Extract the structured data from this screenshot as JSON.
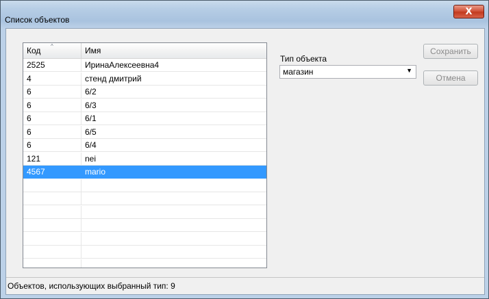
{
  "window": {
    "title": "Список объектов",
    "close_glyph": "X"
  },
  "grid": {
    "columns": {
      "code": "Код",
      "name": "Имя"
    },
    "sort_glyph": "^",
    "rows": [
      {
        "code": "2525",
        "name": "ИринаАлексеевна4"
      },
      {
        "code": "4",
        "name": "стенд дмитрий"
      },
      {
        "code": "6",
        "name": "6/2"
      },
      {
        "code": "6",
        "name": "6/3"
      },
      {
        "code": "6",
        "name": "6/1"
      },
      {
        "code": "6",
        "name": "6/5"
      },
      {
        "code": "6",
        "name": "6/4"
      },
      {
        "code": "121",
        "name": "nei"
      },
      {
        "code": "4567",
        "name": "mario",
        "selected": true
      }
    ],
    "empty_rows": 7
  },
  "object_type": {
    "label": "Тип объекта",
    "value": "магазин",
    "arrow_glyph": "▼"
  },
  "buttons": {
    "save": "Сохранить",
    "cancel": "Отмена"
  },
  "status": {
    "text": "Объектов, использующих выбранный тип: 9"
  },
  "colors": {
    "selection": "#3399ff",
    "close_button": "#c23a1e"
  }
}
